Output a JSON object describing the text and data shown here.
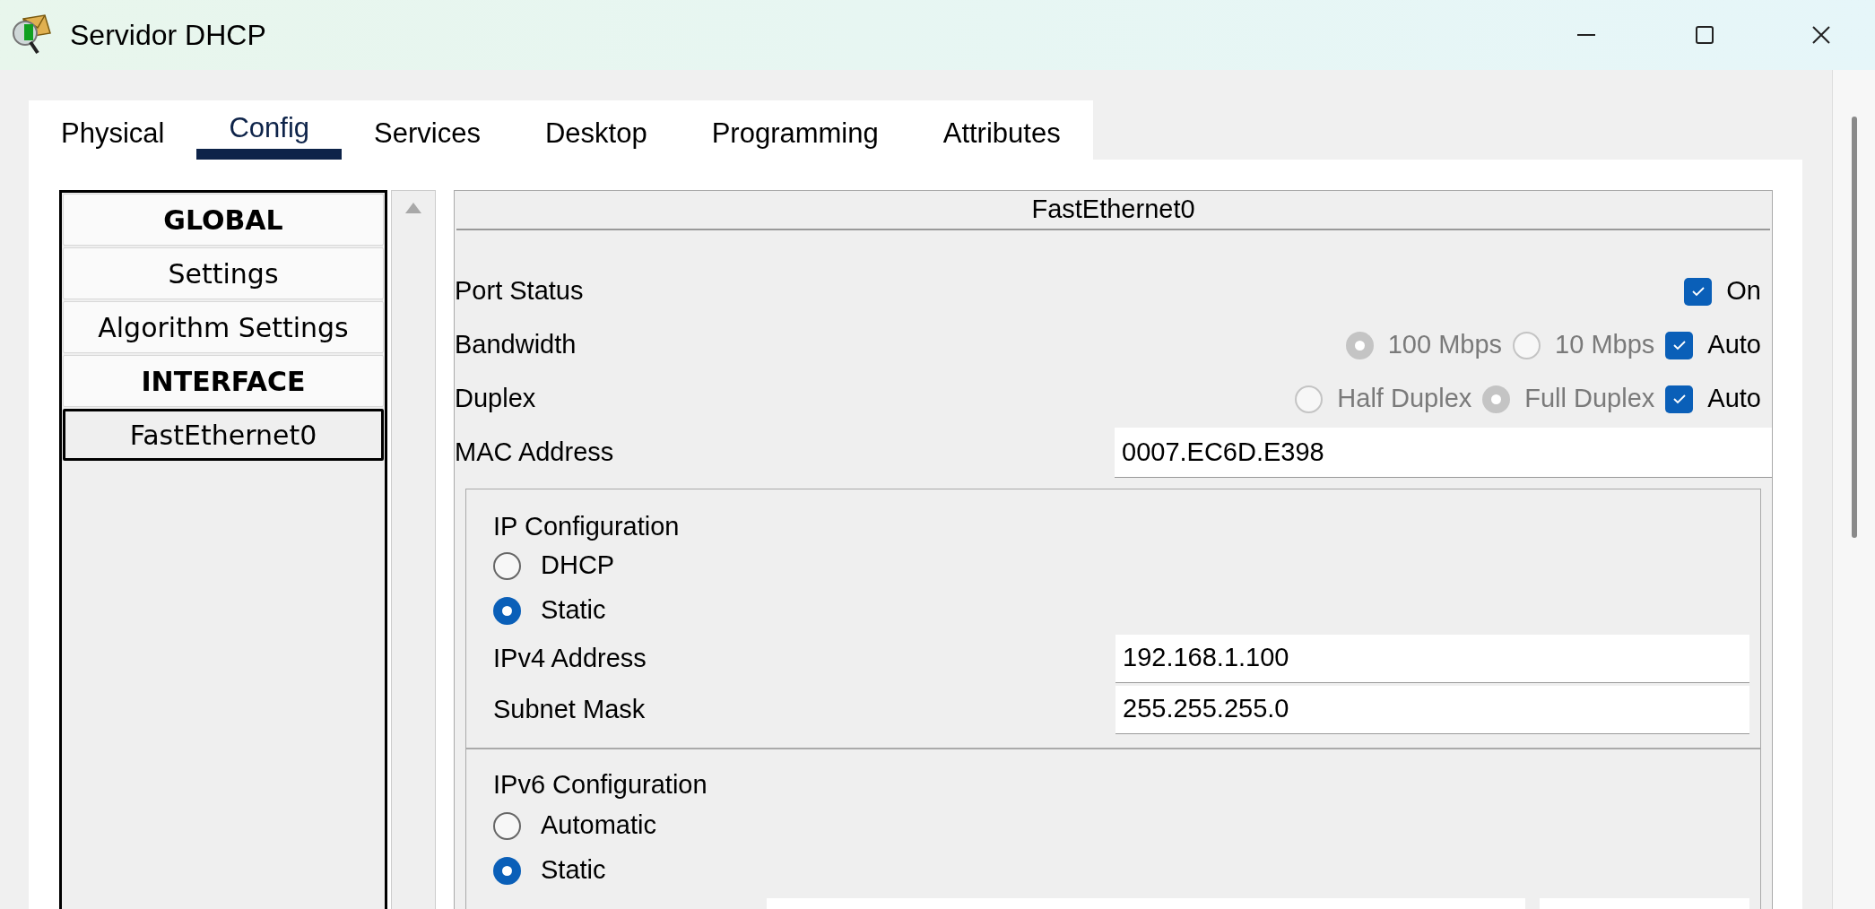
{
  "window": {
    "title": "Servidor DHCP"
  },
  "tabs": [
    {
      "label": "Physical",
      "selected": false
    },
    {
      "label": "Config",
      "selected": true
    },
    {
      "label": "Services",
      "selected": false
    },
    {
      "label": "Desktop",
      "selected": false
    },
    {
      "label": "Programming",
      "selected": false
    },
    {
      "label": "Attributes",
      "selected": false
    }
  ],
  "sidebar": {
    "items": [
      {
        "label": "GLOBAL",
        "kind": "header",
        "selected": false
      },
      {
        "label": "Settings",
        "kind": "item",
        "selected": false
      },
      {
        "label": "Algorithm Settings",
        "kind": "item",
        "selected": false
      },
      {
        "label": "INTERFACE",
        "kind": "header",
        "selected": false
      },
      {
        "label": "FastEthernet0",
        "kind": "item",
        "selected": true
      }
    ]
  },
  "interface": {
    "title": "FastEthernet0",
    "port_status": {
      "label": "Port Status",
      "checkbox": {
        "label": "On",
        "checked": true
      }
    },
    "bandwidth": {
      "label": "Bandwidth",
      "options": [
        {
          "label": "100 Mbps",
          "selected": true
        },
        {
          "label": "10 Mbps",
          "selected": false
        }
      ],
      "auto": {
        "label": "Auto",
        "checked": true
      }
    },
    "duplex": {
      "label": "Duplex",
      "options": [
        {
          "label": "Half Duplex",
          "selected": false
        },
        {
          "label": "Full Duplex",
          "selected": true
        }
      ],
      "auto": {
        "label": "Auto",
        "checked": true
      }
    },
    "mac_address": {
      "label": "MAC Address",
      "value": "0007.EC6D.E398"
    },
    "ip_configuration": {
      "title": "IP Configuration",
      "modes": [
        {
          "label": "DHCP",
          "selected": false
        },
        {
          "label": "Static",
          "selected": true
        }
      ],
      "fields": [
        {
          "label": "IPv4 Address",
          "value": "192.168.1.100"
        },
        {
          "label": "Subnet Mask",
          "value": "255.255.255.0"
        }
      ]
    },
    "ipv6_configuration": {
      "title": "IPv6 Configuration",
      "modes": [
        {
          "label": "Automatic",
          "selected": false
        },
        {
          "label": "Static",
          "selected": true
        }
      ]
    }
  }
}
